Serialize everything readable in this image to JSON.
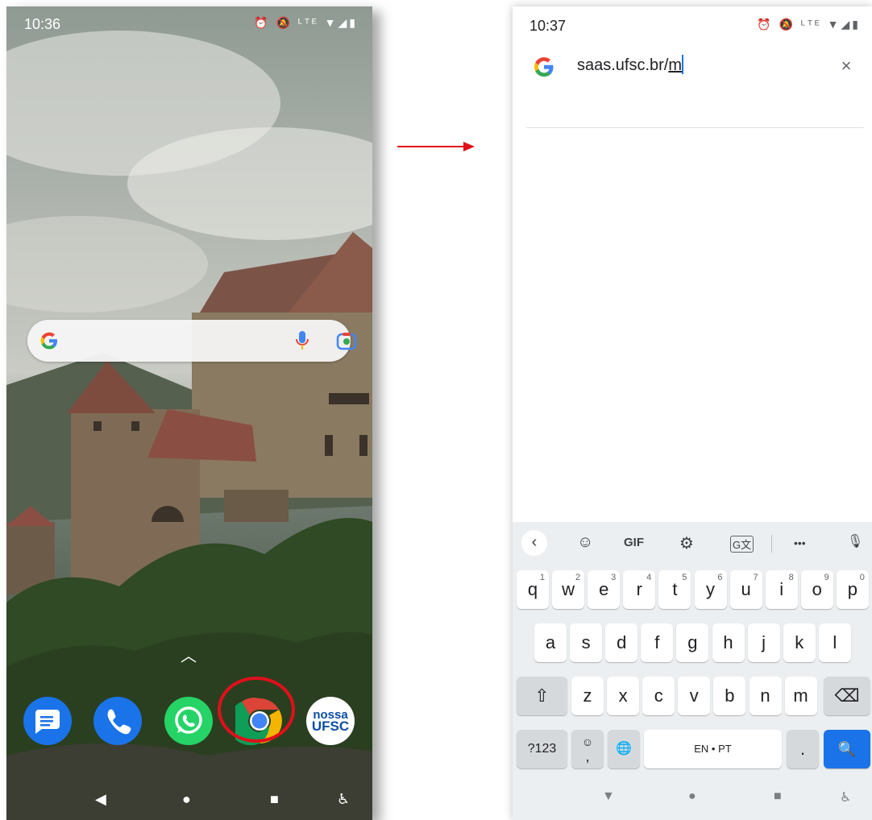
{
  "left_screen": {
    "status_time": "10:36",
    "status_icons": "⏰ 🔕 ᴸᵀᴱ ▼◢▮",
    "search_widget": {
      "logo": "google-g-icon",
      "mic": "mic-icon",
      "lens": "lens-icon"
    },
    "dock": [
      {
        "name": "Messages",
        "icon": "messages-icon"
      },
      {
        "name": "Phone",
        "icon": "phone-icon"
      },
      {
        "name": "WhatsApp",
        "icon": "whatsapp-icon"
      },
      {
        "name": "Chrome",
        "icon": "chrome-icon",
        "highlighted": true
      },
      {
        "name": "Nossa UFSC",
        "icon": "nossa-ufsc-icon",
        "text_line1": "nossa",
        "text_line2": "UFSC"
      }
    ],
    "swipe_hint": "︿",
    "nav": {
      "back": "◀",
      "home": "●",
      "recents": "■",
      "accessibility": "♿"
    }
  },
  "right_screen": {
    "status_time": "10:37",
    "status_icons": "⏰ 🔕 ᴸᵀᴱ ▼◢▮",
    "omnibox": {
      "url_prefix": "saas.ufsc.br/",
      "url_typed": "m",
      "clear": "×"
    },
    "keyboard": {
      "toolbar": {
        "back": "‹",
        "sticker": "☺",
        "gif": "GIF",
        "settings": "⚙",
        "translate": "G文",
        "more": "•••",
        "mic": "🎙"
      },
      "row1": [
        "q",
        "w",
        "e",
        "r",
        "t",
        "y",
        "u",
        "i",
        "o",
        "p"
      ],
      "row1_hints": [
        "1",
        "2",
        "3",
        "4",
        "5",
        "6",
        "7",
        "8",
        "9",
        "0"
      ],
      "row2": [
        "a",
        "s",
        "d",
        "f",
        "g",
        "h",
        "j",
        "k",
        "l"
      ],
      "row3": [
        "z",
        "x",
        "c",
        "v",
        "b",
        "n",
        "m"
      ],
      "shift": "⇧",
      "backspace": "⌫",
      "symbols": "?123",
      "emoji_top": "☺",
      "emoji_bottom": ",",
      "globe": "🌐",
      "space": "EN • PT",
      "period": ".",
      "search": "🔍",
      "nav": {
        "back": "▼",
        "home": "●",
        "recents": "■",
        "accessibility": "♿"
      }
    }
  },
  "colors": {
    "highlight_circle": "#e0101a",
    "arrow": "#e0101a",
    "chrome_blue": "#1a73e8"
  }
}
